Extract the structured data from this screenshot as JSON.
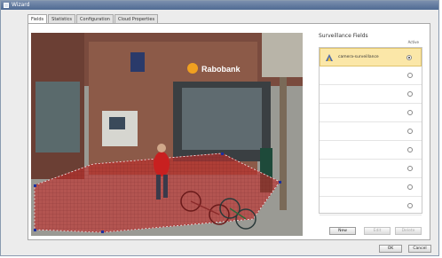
{
  "window": {
    "title": "Wizard"
  },
  "tabs": [
    {
      "label": "Fields",
      "active": true
    },
    {
      "label": "Statistics",
      "active": false
    },
    {
      "label": "Configuration",
      "active": false
    },
    {
      "label": "Cloud Properties",
      "active": false
    }
  ],
  "scene": {
    "store_sign": "Rabobank",
    "zone_color": "#c0302c"
  },
  "side": {
    "title": "Surveillance Fields",
    "active_label": "Active",
    "fields": [
      {
        "name": "camera-surveillance",
        "selected": true,
        "active": true
      },
      {
        "name": "",
        "selected": false,
        "active": false
      },
      {
        "name": "",
        "selected": false,
        "active": false
      },
      {
        "name": "",
        "selected": false,
        "active": false
      },
      {
        "name": "",
        "selected": false,
        "active": false
      },
      {
        "name": "",
        "selected": false,
        "active": false
      },
      {
        "name": "",
        "selected": false,
        "active": false
      },
      {
        "name": "",
        "selected": false,
        "active": false
      },
      {
        "name": "",
        "selected": false,
        "active": false
      }
    ],
    "buttons": {
      "new": "New",
      "edit": "Edit",
      "delete": "Delete"
    }
  },
  "footer": {
    "ok": "OK",
    "cancel": "Cancel"
  }
}
